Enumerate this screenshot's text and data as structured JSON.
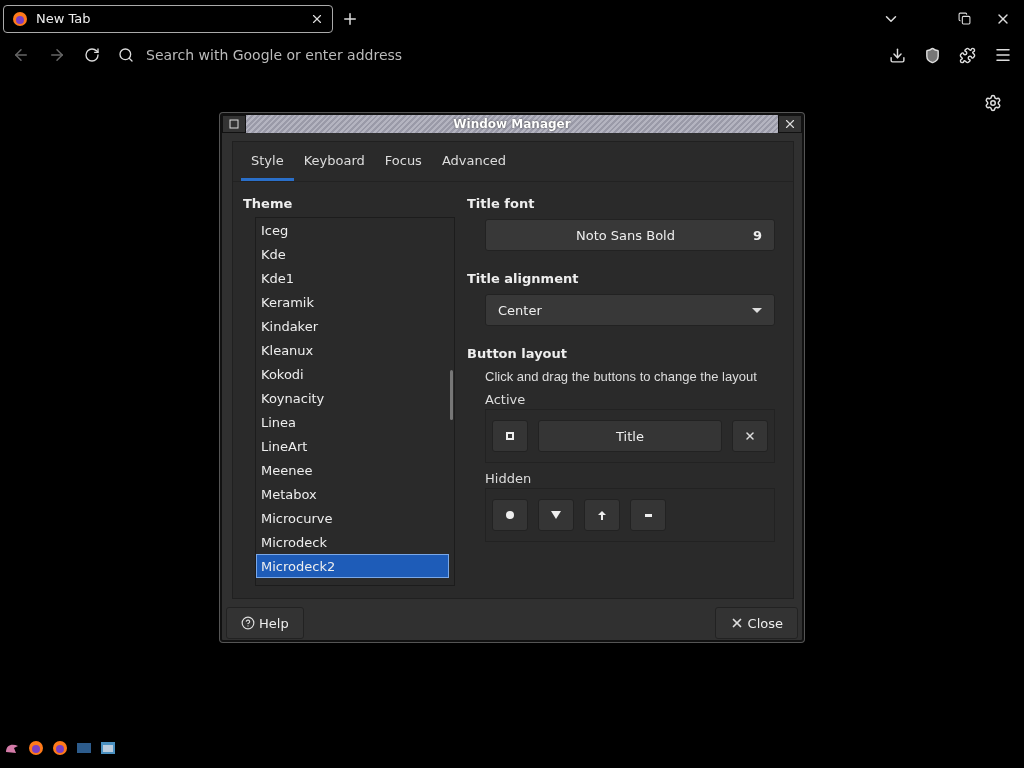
{
  "browser": {
    "tabs": [
      {
        "title": "New Tab",
        "selected": true
      }
    ],
    "address": {
      "placeholder": "Search with Google or enter address"
    }
  },
  "dialog": {
    "title": "Window Manager",
    "tabs": [
      {
        "label": "Style",
        "selected": true
      },
      {
        "label": "Keyboard",
        "selected": false
      },
      {
        "label": "Focus",
        "selected": false
      },
      {
        "label": "Advanced",
        "selected": false
      }
    ],
    "theme": {
      "label": "Theme",
      "items": [
        {
          "label": "Iceg",
          "selected": false
        },
        {
          "label": "Kde",
          "selected": false
        },
        {
          "label": "Kde1",
          "selected": false
        },
        {
          "label": "Keramik",
          "selected": false
        },
        {
          "label": "Kindaker",
          "selected": false
        },
        {
          "label": "Kleanux",
          "selected": false
        },
        {
          "label": "Kokodi",
          "selected": false
        },
        {
          "label": "Koynacity",
          "selected": false
        },
        {
          "label": "Linea",
          "selected": false
        },
        {
          "label": "LineArt",
          "selected": false
        },
        {
          "label": "Meenee",
          "selected": false
        },
        {
          "label": "Metabox",
          "selected": false
        },
        {
          "label": "Microcurve",
          "selected": false
        },
        {
          "label": "Microdeck",
          "selected": false
        },
        {
          "label": "Microdeck2",
          "selected": true
        }
      ]
    },
    "title_font": {
      "label": "Title font",
      "font": "Noto Sans Bold",
      "size": "9"
    },
    "title_alignment": {
      "label": "Title alignment",
      "value": "Center"
    },
    "button_layout": {
      "label": "Button layout",
      "hint": "Click and drag the buttons to change the layout",
      "active": {
        "label": "Active",
        "buttons": [
          {
            "kind": "maximize"
          },
          {
            "kind": "title",
            "label": "Title"
          },
          {
            "kind": "close"
          }
        ]
      },
      "hidden": {
        "label": "Hidden",
        "buttons": [
          {
            "kind": "sticky"
          },
          {
            "kind": "shade"
          },
          {
            "kind": "above"
          },
          {
            "kind": "minimize"
          }
        ]
      }
    },
    "buttons": [
      {
        "kind": "help",
        "label": "Help"
      },
      {
        "kind": "close",
        "label": "Close"
      }
    ]
  }
}
